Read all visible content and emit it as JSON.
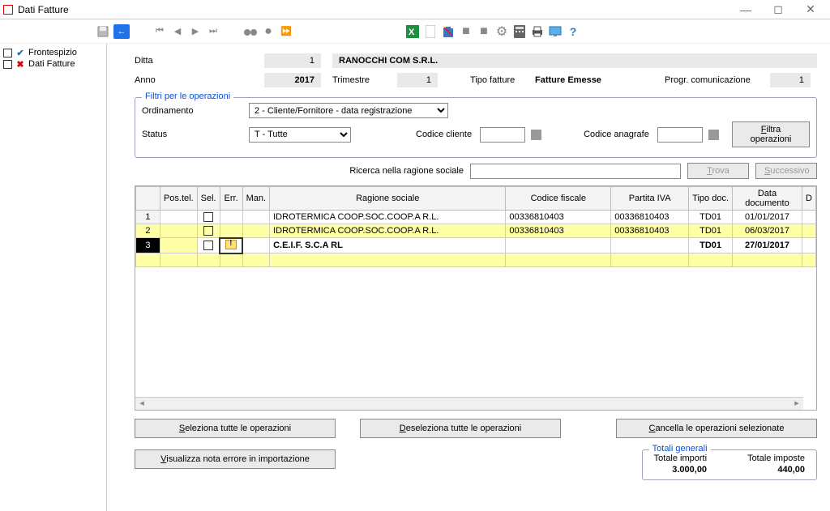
{
  "window": {
    "title": "Dati Fatture",
    "min": "—",
    "max": "◻",
    "close": "✕"
  },
  "tree": {
    "frontespizio": "Frontespizio",
    "dati_fatture": "Dati Fatture"
  },
  "header": {
    "ditta_lbl": "Ditta",
    "ditta_val": "1",
    "ditta_name": "RANOCCHI COM S.R.L.",
    "anno_lbl": "Anno",
    "anno_val": "2017",
    "trimestre_lbl": "Trimestre",
    "trimestre_val": "1",
    "tipo_lbl": "Tipo fatture",
    "tipo_val": "Fatture Emesse",
    "progr_lbl": "Progr. comunicazione",
    "progr_val": "1"
  },
  "filters": {
    "legend": "Filtri per le operazioni",
    "ord_lbl": "Ordinamento",
    "ord_val": "2  - Cliente/Fornitore - data registrazione",
    "status_lbl": "Status",
    "status_val": "T  - Tutte",
    "cod_cliente_lbl": "Codice cliente",
    "cod_anagrafe_lbl": "Codice anagrafe",
    "filtra_btn": "Filtra operazioni"
  },
  "search": {
    "ricerca_lbl": "Ricerca nella ragione sociale",
    "trova_btn": "Trova",
    "succ_btn": "Successivo"
  },
  "grid": {
    "cols": {
      "postel": "Pos.tel.",
      "sel": "Sel.",
      "err": "Err.",
      "man": "Man.",
      "ragione": "Ragione sociale",
      "cf": "Codice fiscale",
      "piva": "Partita IVA",
      "tipo": "Tipo doc.",
      "data": "Data documento",
      "extra": "D"
    },
    "rows": [
      {
        "n": "1",
        "ragione": "IDROTERMICA COOP.SOC.COOP.A R.L.",
        "cf": "00336810403",
        "piva": "00336810403",
        "tipo": "TD01",
        "data": "01/01/2017",
        "yellow": false,
        "sel": false,
        "warn": false
      },
      {
        "n": "2",
        "ragione": "IDROTERMICA COOP.SOC.COOP.A R.L.",
        "cf": "00336810403",
        "piva": "00336810403",
        "tipo": "TD01",
        "data": "06/03/2017",
        "yellow": true,
        "sel": false,
        "warn": false
      },
      {
        "n": "3",
        "ragione": "C.E.I.F. S.C.A RL",
        "cf": "",
        "piva": "",
        "tipo": "TD01",
        "data": "27/01/2017",
        "yellow": false,
        "sel": true,
        "warn": true
      }
    ]
  },
  "buttons": {
    "sel_all": "Seleziona tutte le operazioni",
    "desel_all": "Deseleziona tutte le operazioni",
    "cancella": "Cancella le operazioni selezionate",
    "vis_errore": "Visualizza nota errore in importazione"
  },
  "totals": {
    "legend": "Totali generali",
    "importi_lbl": "Totale importi",
    "importi_val": "3.000,00",
    "imposte_lbl": "Totale imposte",
    "imposte_val": "440,00"
  }
}
